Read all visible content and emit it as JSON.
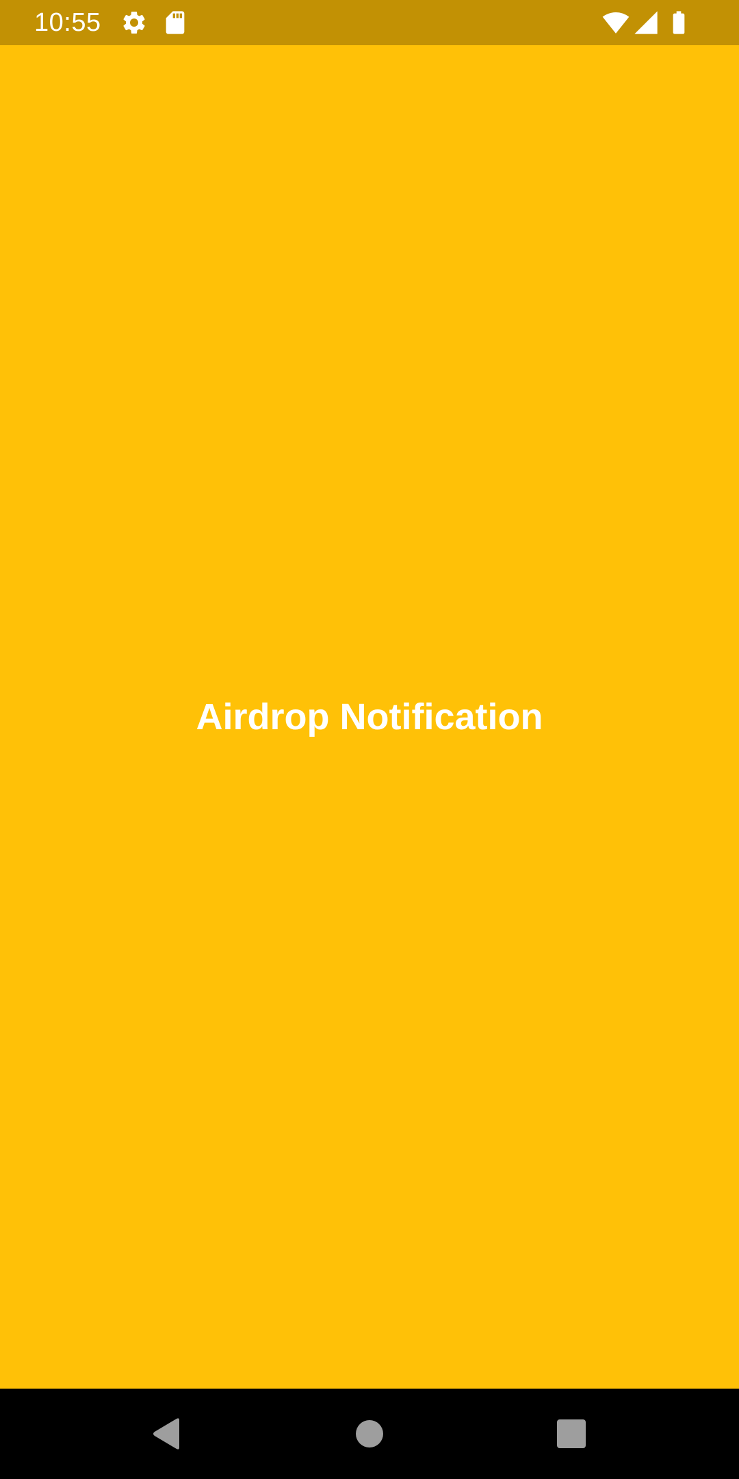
{
  "status_bar": {
    "time": "10:55",
    "icons": [
      "settings-gear-icon",
      "sd-card-icon",
      "wifi-icon",
      "cellular-signal-icon",
      "battery-icon"
    ]
  },
  "main": {
    "title": "Airdrop Notification"
  },
  "nav_bar": {
    "buttons": [
      "back-triangle-icon",
      "home-circle-icon",
      "recents-square-icon"
    ]
  },
  "colors": {
    "background": "#FFC107",
    "status_bar": "#C29104",
    "text": "#FFFFFF",
    "nav_bar": "#000000",
    "nav_icons": "#9E9E9E"
  }
}
